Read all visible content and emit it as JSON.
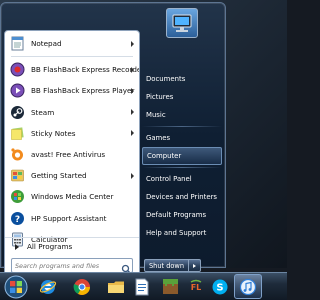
{
  "programs": [
    {
      "label": "Notepad",
      "icon": "notepad-icon",
      "submenu": true
    },
    {
      "label": "BB FlashBack Express Recorder",
      "icon": "bb-flashback-recorder-icon",
      "submenu": true
    },
    {
      "label": "BB FlashBack Express Player",
      "icon": "bb-flashback-player-icon",
      "submenu": true
    },
    {
      "label": "Steam",
      "icon": "steam-icon",
      "submenu": true
    },
    {
      "label": "Sticky Notes",
      "icon": "sticky-notes-icon",
      "submenu": true
    },
    {
      "label": "avast! Free Antivirus",
      "icon": "avast-icon",
      "submenu": false
    },
    {
      "label": "Getting Started",
      "icon": "getting-started-icon",
      "submenu": true
    },
    {
      "label": "Windows Media Center",
      "icon": "windows-media-center-icon",
      "submenu": false
    },
    {
      "label": "HP Support Assistant",
      "icon": "hp-support-icon",
      "submenu": false
    },
    {
      "label": "Calculator",
      "icon": "calculator-icon",
      "submenu": false
    }
  ],
  "all_programs": {
    "label": "All Programs"
  },
  "search": {
    "placeholder": "Search programs and files"
  },
  "right_links": [
    {
      "label": "Documents"
    },
    {
      "label": "Pictures"
    },
    {
      "label": "Music"
    },
    {
      "label": "Games"
    },
    {
      "label": "Computer",
      "highlighted": true
    },
    {
      "label": "Control Panel"
    },
    {
      "label": "Devices and Printers"
    },
    {
      "label": "Default Programs"
    },
    {
      "label": "Help and Support"
    }
  ],
  "shutdown": {
    "label": "Shut down"
  },
  "taskbar": {
    "items": [
      {
        "icon": "internet-explorer-icon"
      },
      {
        "icon": "chrome-icon"
      },
      {
        "icon": "file-explorer-icon"
      },
      {
        "icon": "document-icon"
      },
      {
        "icon": "minecraft-icon"
      },
      {
        "icon": "fl-studio-icon"
      },
      {
        "icon": "skype-icon"
      },
      {
        "icon": "itunes-icon",
        "active": true
      }
    ]
  },
  "colors": {
    "menu_bg": "#0f1f33",
    "left_pane_bg": "#ffffff",
    "right_text": "#ffffff",
    "taskbar_bg": "#1e2b3b"
  }
}
